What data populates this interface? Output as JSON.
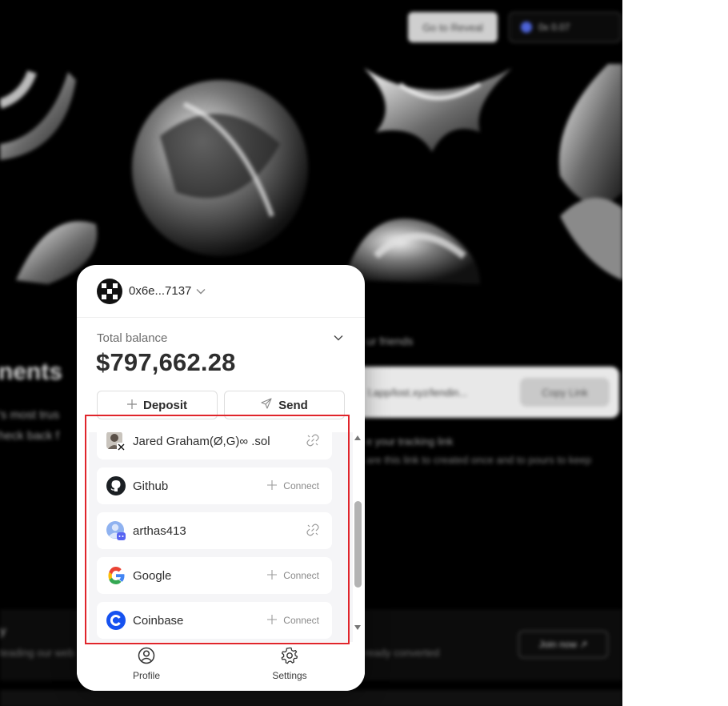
{
  "background": {
    "reveal_button": "Go to Reveal",
    "wallet_button": "0x 0.07",
    "hero_heading": "nents",
    "hero_sub1": "'s most trus",
    "hero_sub2": "heck back f",
    "friends_label": "ur friends",
    "invite_link": "l.app/lost.xyz/lendin...",
    "copy_link_button": "Copy Link",
    "tracking_title": "e your tracking link",
    "tracking_sub": "are this link to created once and to pours to keep",
    "lower_letter": "y",
    "lower_text": "teading our web",
    "lower_text2": "ready converted",
    "join_button": "Join now ↗",
    "colors": {
      "bg": "#000000",
      "panel": "#0c0c0c"
    }
  },
  "wallet": {
    "address": "0x6e...7137",
    "balance_label": "Total balance",
    "balance": "$797,662.28",
    "deposit_label": "Deposit",
    "send_label": "Send",
    "accounts": [
      {
        "label": "Jared Graham(Ø,G)∞ .sol",
        "icon": "x-twitter-avatar-icon",
        "action": "unlink"
      },
      {
        "label": "Github",
        "icon": "github-icon",
        "action": "Connect"
      },
      {
        "label": "arthas413",
        "icon": "discord-avatar-icon",
        "action": "unlink"
      },
      {
        "label": "Google",
        "icon": "google-icon",
        "action": "Connect"
      },
      {
        "label": "Coinbase",
        "icon": "coinbase-icon",
        "action": "Connect"
      }
    ],
    "tabs": {
      "profile": "Profile",
      "settings": "Settings"
    },
    "scroll_position": 0.45,
    "colors": {
      "highlight": "#e0252b",
      "list_bg": "#f5f5f7",
      "coinbase": "#1652f0",
      "discord": "#5865f2"
    }
  }
}
